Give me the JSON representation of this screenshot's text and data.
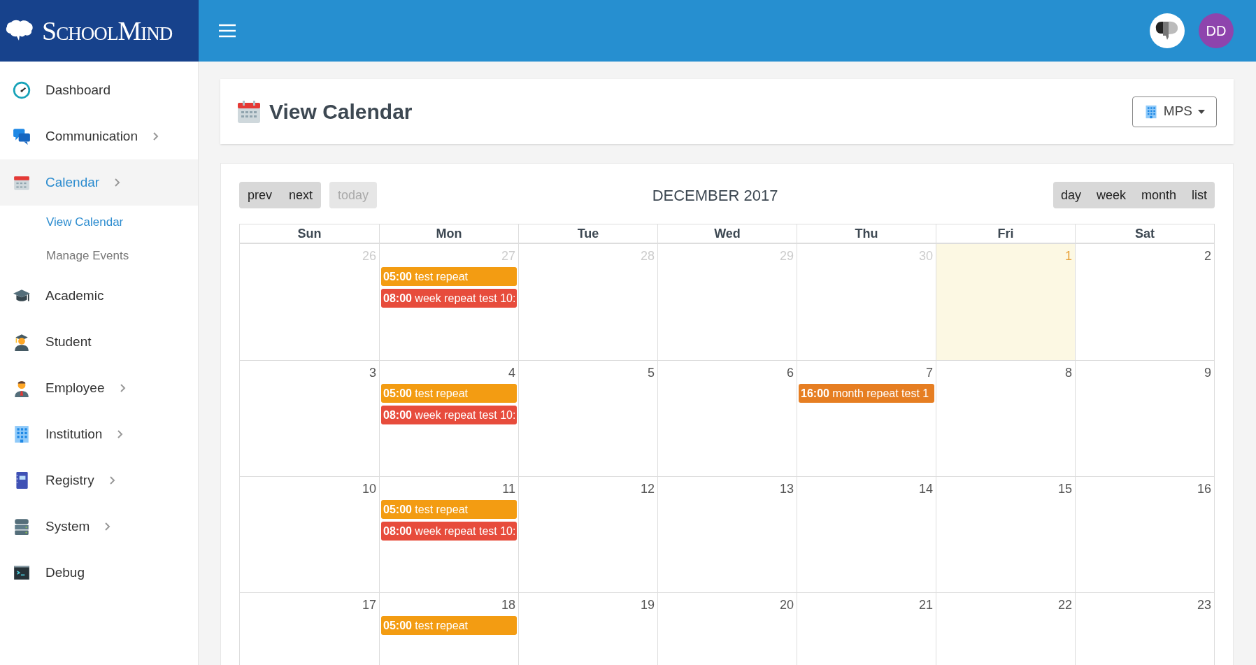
{
  "header": {
    "logo_text": "SchoolMind",
    "avatar_initials": "DD"
  },
  "sidebar": {
    "items": [
      {
        "label": "Dashboard",
        "selected": false,
        "submenu": false
      },
      {
        "label": "Communication",
        "selected": false,
        "submenu": true
      },
      {
        "label": "Calendar",
        "selected": true,
        "submenu": true,
        "children": [
          {
            "label": "View Calendar",
            "selected": true
          },
          {
            "label": "Manage Events",
            "selected": false
          }
        ]
      },
      {
        "label": "Academic",
        "selected": false,
        "submenu": false
      },
      {
        "label": "Student",
        "selected": false,
        "submenu": false
      },
      {
        "label": "Employee",
        "selected": false,
        "submenu": true
      },
      {
        "label": "Institution",
        "selected": false,
        "submenu": true
      },
      {
        "label": "Registry",
        "selected": false,
        "submenu": true
      },
      {
        "label": "System",
        "selected": false,
        "submenu": true
      },
      {
        "label": "Debug",
        "selected": false,
        "submenu": false
      }
    ]
  },
  "page": {
    "title": "View Calendar",
    "selector": "MPS"
  },
  "calendar": {
    "nav_buttons": [
      "prev",
      "next"
    ],
    "today_button": {
      "label": "today",
      "disabled": true
    },
    "title": "DECEMBER 2017",
    "view_buttons": [
      "day",
      "week",
      "month",
      "list"
    ],
    "columns": [
      "Sun",
      "Mon",
      "Tue",
      "Wed",
      "Thu",
      "Fri",
      "Sat"
    ],
    "weeks": [
      {
        "days": [
          {
            "day": "26",
            "other_month": true,
            "today": false
          },
          {
            "day": "27",
            "other_month": true,
            "today": false,
            "events": [
              {
                "text": "**05:00** test repeat",
                "color": "#f39c12"
              },
              {
                "text": "**08:00** week repeat test 10:",
                "color": "#e74c3c"
              }
            ]
          },
          {
            "day": "28",
            "other_month": true,
            "today": false
          },
          {
            "day": "29",
            "other_month": true,
            "today": false
          },
          {
            "day": "30",
            "other_month": true,
            "today": false
          },
          {
            "day": "1",
            "other_month": false,
            "today": true
          },
          {
            "day": "2",
            "other_month": false,
            "today": false
          }
        ]
      },
      {
        "days": [
          {
            "day": "3",
            "other_month": false,
            "today": false
          },
          {
            "day": "4",
            "other_month": false,
            "today": false,
            "events": [
              {
                "text": "**05:00** test repeat",
                "color": "#f39c12"
              },
              {
                "text": "**08:00** week repeat test 10:",
                "color": "#e74c3c"
              }
            ]
          },
          {
            "day": "5",
            "other_month": false,
            "today": false
          },
          {
            "day": "6",
            "other_month": false,
            "today": false
          },
          {
            "day": "7",
            "other_month": false,
            "today": false,
            "events": [
              {
                "text": "**16:00** month repeat test 1",
                "color": "#e67e22"
              }
            ]
          },
          {
            "day": "8",
            "other_month": false,
            "today": false
          },
          {
            "day": "9",
            "other_month": false,
            "today": false
          }
        ]
      },
      {
        "days": [
          {
            "day": "10",
            "other_month": false,
            "today": false
          },
          {
            "day": "11",
            "other_month": false,
            "today": false,
            "events": [
              {
                "text": "**05:00** test repeat",
                "color": "#f39c12"
              },
              {
                "text": "**08:00** week repeat test 10:",
                "color": "#e74c3c"
              }
            ]
          },
          {
            "day": "12",
            "other_month": false,
            "today": false
          },
          {
            "day": "13",
            "other_month": false,
            "today": false
          },
          {
            "day": "14",
            "other_month": false,
            "today": false
          },
          {
            "day": "15",
            "other_month": false,
            "today": false
          },
          {
            "day": "16",
            "other_month": false,
            "today": false
          }
        ]
      },
      {
        "days": [
          {
            "day": "17",
            "other_month": false,
            "today": false
          },
          {
            "day": "18",
            "other_month": false,
            "today": false,
            "events": [
              {
                "text": "**05:00** test repeat",
                "color": "#f39c12"
              }
            ]
          },
          {
            "day": "19",
            "other_month": false,
            "today": false
          },
          {
            "day": "20",
            "other_month": false,
            "today": false
          },
          {
            "day": "21",
            "other_month": false,
            "today": false
          },
          {
            "day": "22",
            "other_month": false,
            "today": false
          },
          {
            "day": "23",
            "other_month": false,
            "today": false
          }
        ]
      }
    ]
  }
}
